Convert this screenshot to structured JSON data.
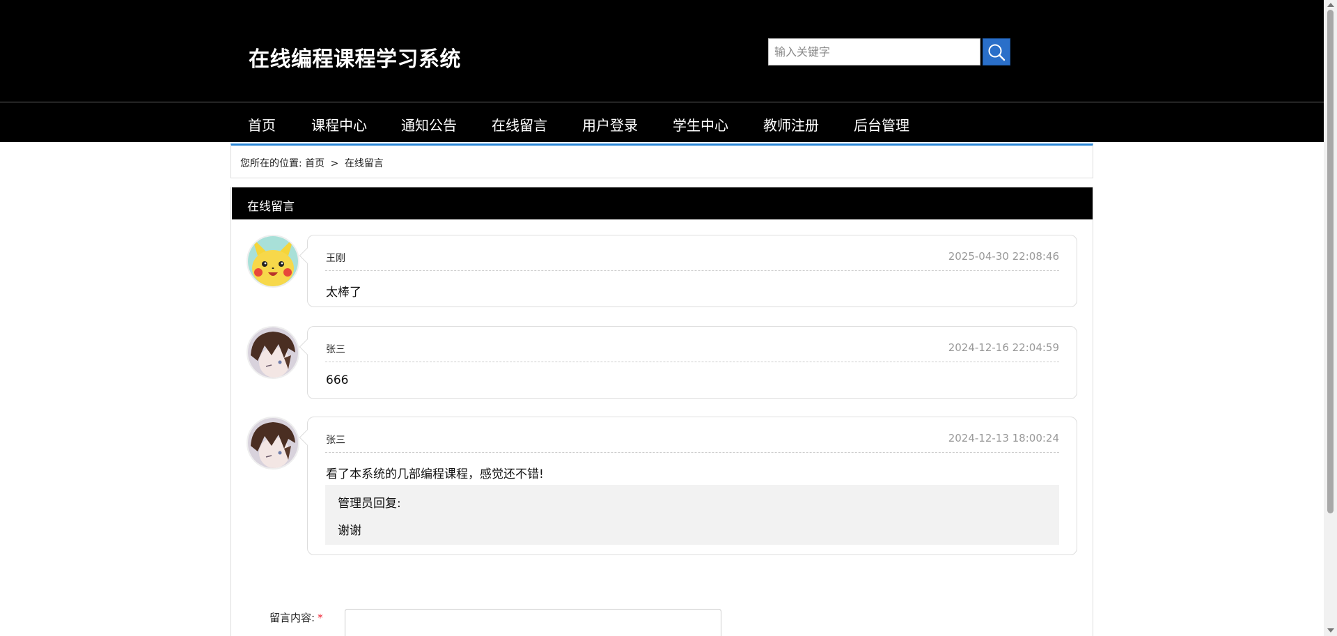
{
  "header": {
    "site_title": "在线编程课程学习系统",
    "search_placeholder": "输入关键字"
  },
  "nav": {
    "items": [
      "首页",
      "课程中心",
      "通知公告",
      "在线留言",
      "用户登录",
      "学生中心",
      "教师注册",
      "后台管理"
    ]
  },
  "breadcrumb": {
    "prefix": "您所在的位置:",
    "home": "首页",
    "separator": ">",
    "current": "在线留言"
  },
  "panel": {
    "title": "在线留言"
  },
  "messages": [
    {
      "user": "王刚",
      "time": "2025-04-30 22:08:46",
      "content": "太棒了",
      "avatar": "pikachu-avatar"
    },
    {
      "user": "张三",
      "time": "2024-12-16 22:04:59",
      "content": "666",
      "avatar": "anime-boy-avatar"
    },
    {
      "user": "张三",
      "time": "2024-12-13 18:00:24",
      "content": "看了本系统的几部编程课程，感觉还不错!",
      "avatar": "anime-boy-avatar",
      "reply": {
        "label": "管理员回复:",
        "content": "谢谢"
      }
    }
  ],
  "form": {
    "content_label": "留言内容:",
    "required_mark": "*"
  },
  "colors": {
    "header_bg": "#000000",
    "search_button": "#2a6fc9",
    "breadcrumb_accent": "#2a86d6",
    "required": "#e23333"
  }
}
